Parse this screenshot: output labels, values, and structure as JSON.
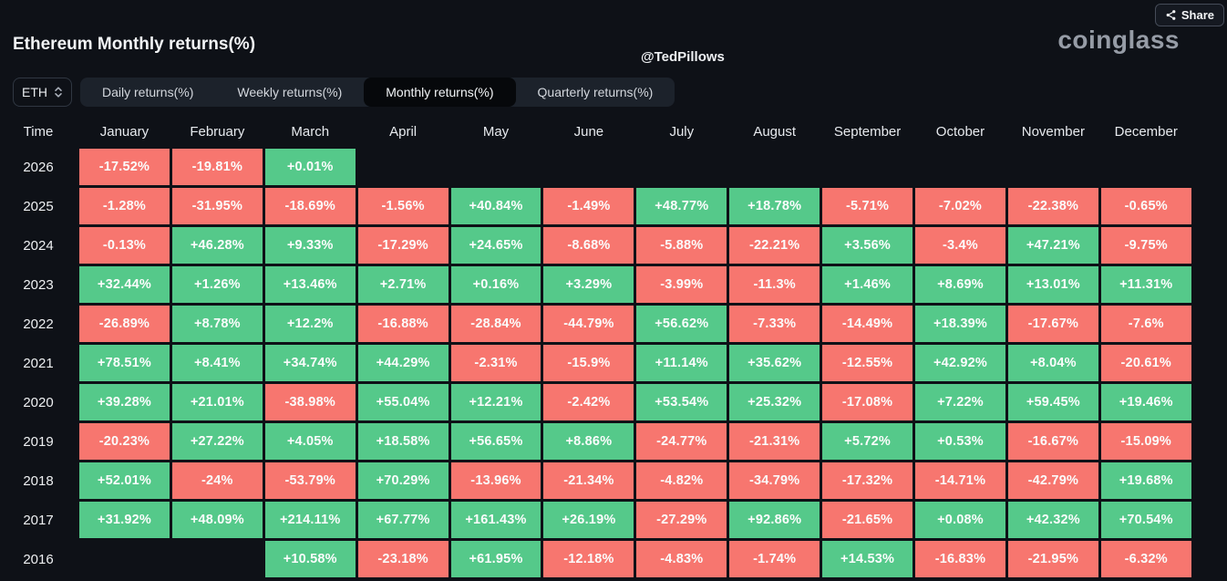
{
  "header": {
    "title": "Ethereum Monthly returns(%)",
    "watermark": "@TedPillows",
    "logo_text": "coinglass",
    "share_label": "Share"
  },
  "controls": {
    "symbol": "ETH",
    "tabs": [
      {
        "label": "Daily returns(%)",
        "active": false
      },
      {
        "label": "Weekly returns(%)",
        "active": false
      },
      {
        "label": "Monthly returns(%)",
        "active": true
      },
      {
        "label": "Quarterly returns(%)",
        "active": false
      }
    ]
  },
  "colors": {
    "positive": "#55c98a",
    "negative": "#f7766f",
    "background": "#0e1117"
  },
  "chart_data": {
    "type": "heatmap",
    "title": "Ethereum Monthly returns(%)",
    "row_header": "Time",
    "columns": [
      "January",
      "February",
      "March",
      "April",
      "May",
      "June",
      "July",
      "August",
      "September",
      "October",
      "November",
      "December"
    ],
    "rows": [
      {
        "year": "2026",
        "values": [
          "-17.52%",
          "-19.81%",
          "+0.01%",
          "",
          "",
          "",
          "",
          "",
          "",
          "",
          "",
          ""
        ]
      },
      {
        "year": "2025",
        "values": [
          "-1.28%",
          "-31.95%",
          "-18.69%",
          "-1.56%",
          "+40.84%",
          "-1.49%",
          "+48.77%",
          "+18.78%",
          "-5.71%",
          "-7.02%",
          "-22.38%",
          "-0.65%"
        ]
      },
      {
        "year": "2024",
        "values": [
          "-0.13%",
          "+46.28%",
          "+9.33%",
          "-17.29%",
          "+24.65%",
          "-8.68%",
          "-5.88%",
          "-22.21%",
          "+3.56%",
          "-3.4%",
          "+47.21%",
          "-9.75%"
        ]
      },
      {
        "year": "2023",
        "values": [
          "+32.44%",
          "+1.26%",
          "+13.46%",
          "+2.71%",
          "+0.16%",
          "+3.29%",
          "-3.99%",
          "-11.3%",
          "+1.46%",
          "+8.69%",
          "+13.01%",
          "+11.31%"
        ]
      },
      {
        "year": "2022",
        "values": [
          "-26.89%",
          "+8.78%",
          "+12.2%",
          "-16.88%",
          "-28.84%",
          "-44.79%",
          "+56.62%",
          "-7.33%",
          "-14.49%",
          "+18.39%",
          "-17.67%",
          "-7.6%"
        ]
      },
      {
        "year": "2021",
        "values": [
          "+78.51%",
          "+8.41%",
          "+34.74%",
          "+44.29%",
          "-2.31%",
          "-15.9%",
          "+11.14%",
          "+35.62%",
          "-12.55%",
          "+42.92%",
          "+8.04%",
          "-20.61%"
        ]
      },
      {
        "year": "2020",
        "values": [
          "+39.28%",
          "+21.01%",
          "-38.98%",
          "+55.04%",
          "+12.21%",
          "-2.42%",
          "+53.54%",
          "+25.32%",
          "-17.08%",
          "+7.22%",
          "+59.45%",
          "+19.46%"
        ]
      },
      {
        "year": "2019",
        "values": [
          "-20.23%",
          "+27.22%",
          "+4.05%",
          "+18.58%",
          "+56.65%",
          "+8.86%",
          "-24.77%",
          "-21.31%",
          "+5.72%",
          "+0.53%",
          "-16.67%",
          "-15.09%"
        ]
      },
      {
        "year": "2018",
        "values": [
          "+52.01%",
          "-24%",
          "-53.79%",
          "+70.29%",
          "-13.96%",
          "-21.34%",
          "-4.82%",
          "-34.79%",
          "-17.32%",
          "-14.71%",
          "-42.79%",
          "+19.68%"
        ]
      },
      {
        "year": "2017",
        "values": [
          "+31.92%",
          "+48.09%",
          "+214.11%",
          "+67.77%",
          "+161.43%",
          "+26.19%",
          "-27.29%",
          "+92.86%",
          "-21.65%",
          "+0.08%",
          "+42.32%",
          "+70.54%"
        ]
      },
      {
        "year": "2016",
        "values": [
          "",
          "",
          "+10.58%",
          "-23.18%",
          "+61.95%",
          "-12.18%",
          "-4.83%",
          "-1.74%",
          "+14.53%",
          "-16.83%",
          "-21.95%",
          "-6.32%"
        ]
      }
    ]
  }
}
